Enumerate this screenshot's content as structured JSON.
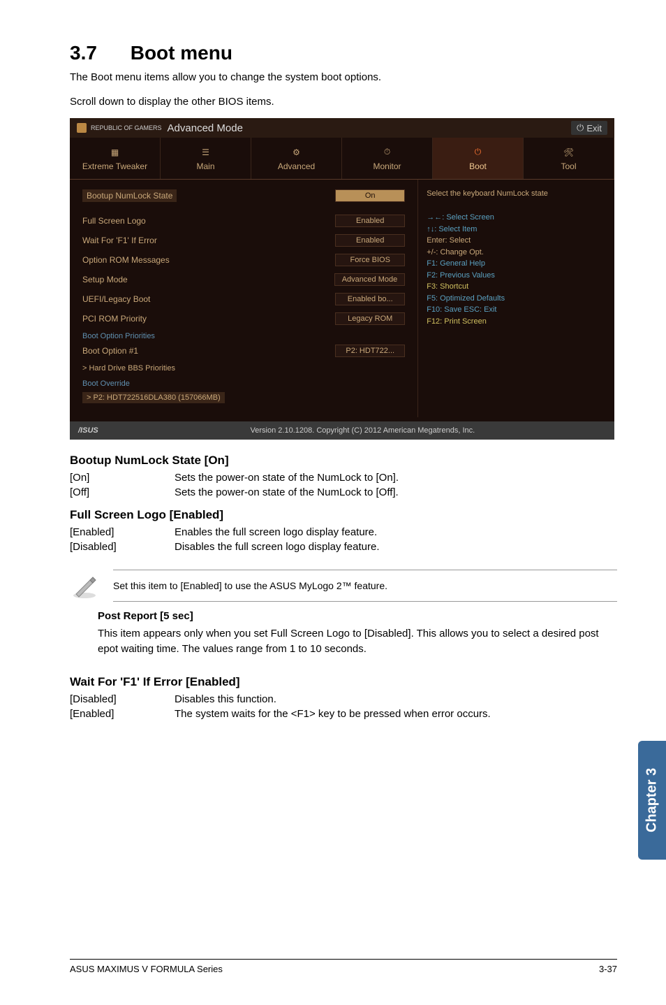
{
  "section": {
    "number": "3.7",
    "title": "Boot menu"
  },
  "intro": {
    "p1": "The Boot menu items allow you to change the system boot options.",
    "p2": "Scroll down to display the other BIOS items."
  },
  "bios": {
    "brand": "REPUBLIC OF GAMERS",
    "mode": "Advanced Mode",
    "exit": "Exit",
    "tabs": {
      "0": "Extreme Tweaker",
      "1": "Main",
      "2": "Advanced",
      "3": "Monitor",
      "4": "Boot",
      "5": "Tool"
    },
    "settings": {
      "numlock": {
        "label": "Bootup NumLock State",
        "val": "On"
      },
      "logo": {
        "label": "Full Screen Logo",
        "val": "Enabled"
      },
      "f1": {
        "label": "Wait For 'F1' If Error",
        "val": "Enabled"
      },
      "rom": {
        "label": "Option ROM Messages",
        "val": "Force BIOS"
      },
      "setup": {
        "label": "Setup Mode",
        "val": "Advanced Mode"
      },
      "uefi": {
        "label": "UEFI/Legacy Boot",
        "val": "Enabled bo..."
      },
      "pci": {
        "label": "PCI ROM Priority",
        "val": "Legacy ROM"
      }
    },
    "bootprio": {
      "header": "Boot Option Priorities",
      "opt1": {
        "label": "Boot Option #1",
        "val": "P2: HDT722..."
      },
      "hdd": "> Hard Drive BBS Priorities",
      "override": "Boot Override",
      "p2": "> P2: HDT722516DLA380  (157066MB)"
    },
    "help": {
      "title": "Select the keyboard NumLock state",
      "keys": {
        "k1": "→←: Select Screen",
        "k2": "↑↓: Select Item",
        "k3": "Enter: Select",
        "k4": "+/-: Change Opt.",
        "k5": "F1: General Help",
        "k6": "F2: Previous Values",
        "k7": "F3: Shortcut",
        "k8": "F5: Optimized Defaults",
        "k9": "F10: Save  ESC: Exit",
        "k10": "F12: Print Screen"
      }
    },
    "footer": {
      "asus": "/ISUS",
      "ver": "Version 2.10.1208. Copyright (C) 2012 American Megatrends, Inc."
    }
  },
  "sections": {
    "numlock": {
      "title": "Bootup NumLock State [On]",
      "on": {
        "k": "[On]",
        "d": "Sets the power-on state of the NumLock to [On]."
      },
      "off": {
        "k": "[Off]",
        "d": "Sets the power-on state of the NumLock to [Off]."
      }
    },
    "logo": {
      "title": "Full Screen Logo [Enabled]",
      "en": {
        "k": "[Enabled]",
        "d": "Enables the full screen logo display feature."
      },
      "di": {
        "k": "[Disabled]",
        "d": "Disables the full screen logo display feature."
      }
    },
    "note": "Set this item to [Enabled] to use the ASUS MyLogo 2™ feature.",
    "post": {
      "title": "Post Report [5 sec]",
      "body": "This item appears only when you set Full Screen Logo to [Disabled]. This allows you to select a desired post epot waiting time. The values range from 1 to 10 seconds."
    },
    "f1": {
      "title": "Wait For 'F1' If Error [Enabled]",
      "di": {
        "k": "[Disabled]",
        "d": "Disables this function."
      },
      "en": {
        "k": "[Enabled]",
        "d": "The system waits for the <F1> key to be pressed when error occurs."
      }
    }
  },
  "side": "Chapter 3",
  "footer": {
    "left": "ASUS MAXIMUS V FORMULA Series",
    "right": "3-37"
  }
}
